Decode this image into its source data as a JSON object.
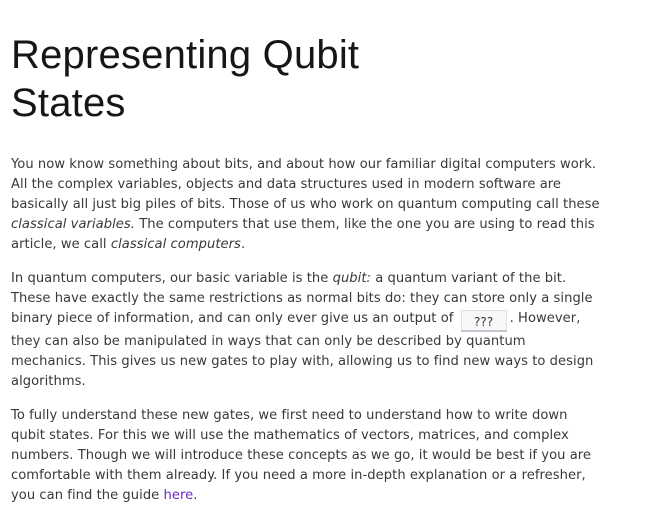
{
  "article": {
    "title_line1": "Representing Qubit",
    "title_line2": "States",
    "p1": {
      "t1": "You now know something about bits, and about how our familiar digital computers work. All the complex variables, objects and data structures used in modern software are basically all just big piles of bits. Those of us who work on quantum computing call these ",
      "em1": "classical variables.",
      "t2": " The computers that use them, like the one you are using to read this article, we call ",
      "em2": "classical computers",
      "t3": "."
    },
    "p2": {
      "t1": "In quantum computers, our basic variable is the ",
      "em1": "qubit:",
      "t2": " a quantum variant of the bit. These have exactly the same restrictions as normal bits do: they can store only a single binary piece of information, and can only ever give us an output of ",
      "widget": "???",
      "t3": ". However, they can also be manipulated in ways that can only be described by quantum mechanics. This gives us new gates to play with, allowing us to find new ways to design algorithms."
    },
    "p3": {
      "t1": "To fully understand these new gates, we first need to understand how to write down qubit states. For this we will use the mathematics of vectors, matrices, and complex numbers. Though we will introduce these concepts as we go, it would be best if you are comfortable with them already. If you need a more in-depth explanation or a refresher, you can find the guide ",
      "link": "here",
      "t2": "."
    }
  },
  "colors": {
    "heading": "#161616",
    "body_text": "#393939",
    "link": "#6929c4"
  }
}
